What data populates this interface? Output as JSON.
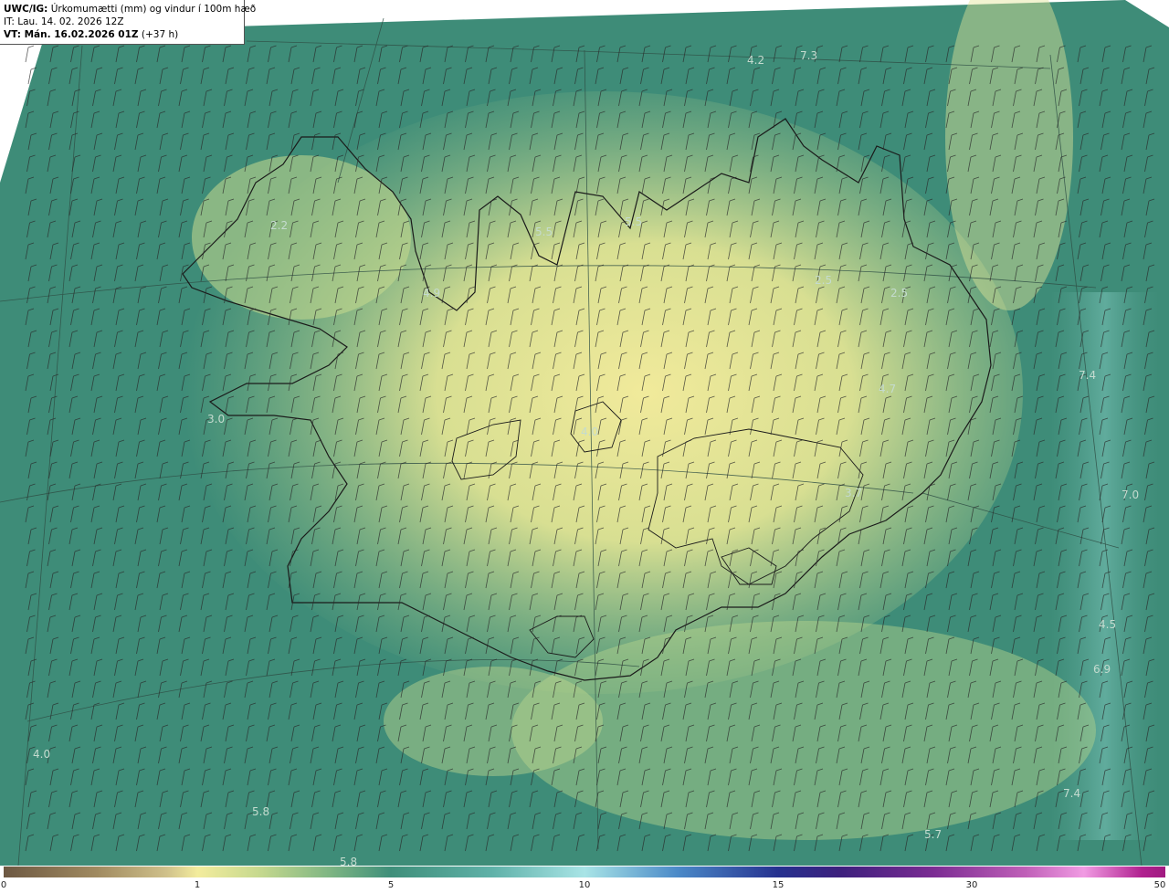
{
  "header": {
    "product_label": "UWC/IG:",
    "title": "Úrkomumætti (mm) og vindur í 100m hæð",
    "init_time": "IT: Lau. 14. 02. 2026 12Z",
    "valid_label": "VT: Mán. 16.02.2026 01Z",
    "valid_offset": "(+37 h)"
  },
  "colorbar": {
    "ticks": [
      {
        "label": "0",
        "value": 0
      },
      {
        "label": "1",
        "value": 1
      },
      {
        "label": "5",
        "value": 5
      },
      {
        "label": "10",
        "value": 10
      },
      {
        "label": "15",
        "value": 15
      },
      {
        "label": "30",
        "value": 30
      },
      {
        "label": "50",
        "value": 50
      }
    ]
  },
  "map": {
    "value_labels": [
      "4.2",
      "7.3",
      "2.2",
      "5.5",
      "5.5",
      "4.9",
      "2.5",
      "2.5",
      "7.4",
      "4.7",
      "3.0",
      "4.0",
      "3.7",
      "7.0",
      "4.5",
      "6.9",
      "4.0",
      "5.8",
      "7.4",
      "5.7",
      "5.8"
    ],
    "colors": {
      "ocean": "#3f8f7a",
      "land": "#f3ec9d",
      "coastline": "#1a1a1a",
      "barb": "#2a2a2a"
    }
  }
}
